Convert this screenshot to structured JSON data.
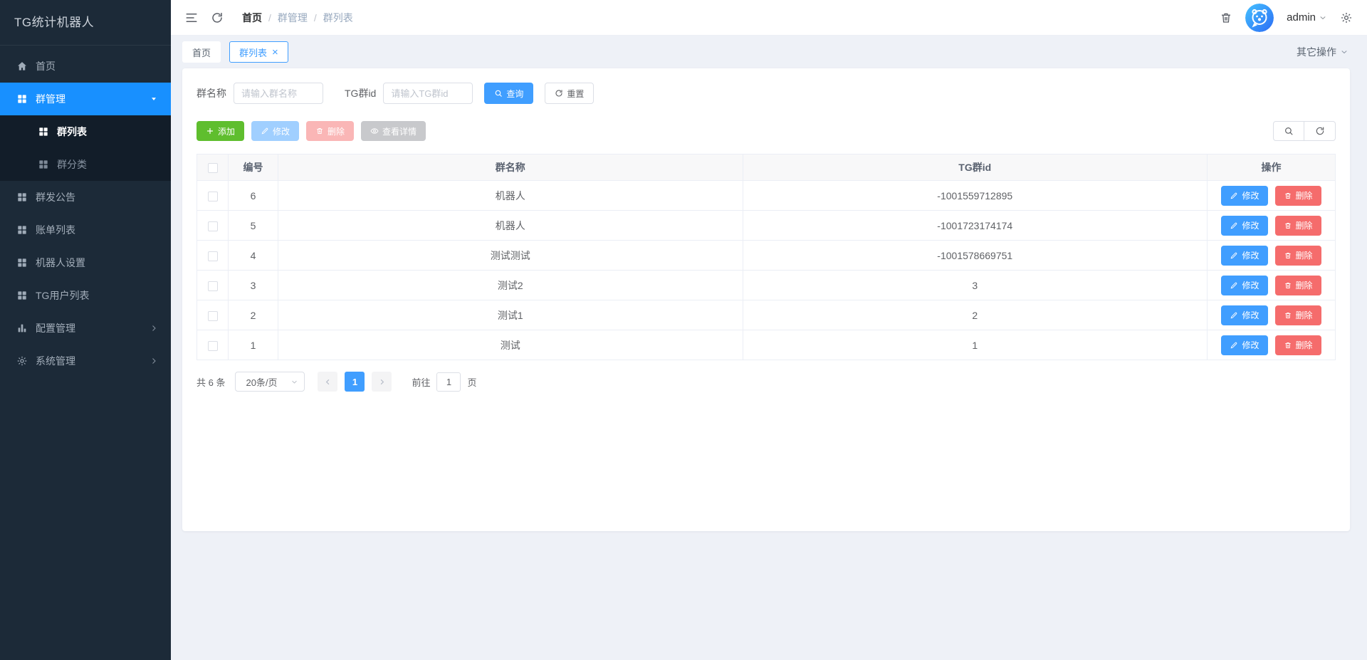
{
  "app": {
    "logo": "TG统计机器人"
  },
  "sidebar": {
    "items": [
      {
        "key": "home",
        "label": "首页",
        "icon": "home-icon"
      },
      {
        "key": "group-management",
        "label": "群管理",
        "icon": "grid-icon",
        "active": true,
        "arrow": "down"
      },
      {
        "key": "group-list",
        "label": "群列表",
        "icon": "grid-icon",
        "child": true,
        "active": true
      },
      {
        "key": "group-category",
        "label": "群分类",
        "icon": "grid-icon",
        "child": true
      },
      {
        "key": "group-broadcast",
        "label": "群发公告",
        "icon": "grid-icon"
      },
      {
        "key": "billing-list",
        "label": "账单列表",
        "icon": "grid-icon"
      },
      {
        "key": "robot-settings",
        "label": "机器人设置",
        "icon": "grid-icon"
      },
      {
        "key": "tg-user-list",
        "label": "TG用户列表",
        "icon": "grid-icon"
      },
      {
        "key": "config-management",
        "label": "配置管理",
        "icon": "chart-icon",
        "arrow": "right"
      },
      {
        "key": "system-management",
        "label": "系统管理",
        "icon": "gear-icon",
        "arrow": "right"
      }
    ]
  },
  "header": {
    "breadcrumb": [
      "首页",
      "群管理",
      "群列表"
    ],
    "user": "admin"
  },
  "tabs": [
    {
      "key": "home",
      "label": "首页"
    },
    {
      "key": "group-list",
      "label": "群列表",
      "active": true,
      "closable": true
    }
  ],
  "tabbar": {
    "more_label": "其它操作"
  },
  "filters": {
    "name_label": "群名称",
    "name_placeholder": "请输入群名称",
    "tgid_label": "TG群id",
    "tgid_placeholder": "请输入TG群id",
    "search_label": "查询",
    "reset_label": "重置"
  },
  "toolbar": {
    "add_label": "添加",
    "edit_label": "修改",
    "delete_label": "删除",
    "detail_label": "查看详情"
  },
  "table": {
    "columns": [
      "编号",
      "群名称",
      "TG群id",
      "操作"
    ],
    "rows": [
      {
        "id": "6",
        "name": "机器人",
        "tgid": "-1001559712895"
      },
      {
        "id": "5",
        "name": "机器人",
        "tgid": "-1001723174174"
      },
      {
        "id": "4",
        "name": "测试测试",
        "tgid": "-1001578669751"
      },
      {
        "id": "3",
        "name": "测试2",
        "tgid": "3"
      },
      {
        "id": "2",
        "name": "测试1",
        "tgid": "2"
      },
      {
        "id": "1",
        "name": "测试",
        "tgid": "1"
      }
    ],
    "row_actions": {
      "edit": "修改",
      "delete": "删除"
    }
  },
  "pagination": {
    "total_text": "共 6 条",
    "page_size_text": "20条/页",
    "current_page": "1",
    "goto_label": "前往",
    "goto_value": "1",
    "page_suffix": "页"
  },
  "colors": {
    "primary": "#409EFF",
    "success": "#5fbe2e",
    "danger": "#F56C6C",
    "sidebar_bg": "#1c2a38",
    "submenu_bg": "#121d29",
    "sidebar_active": "#1890ff",
    "content_bg": "#eef1f7"
  }
}
